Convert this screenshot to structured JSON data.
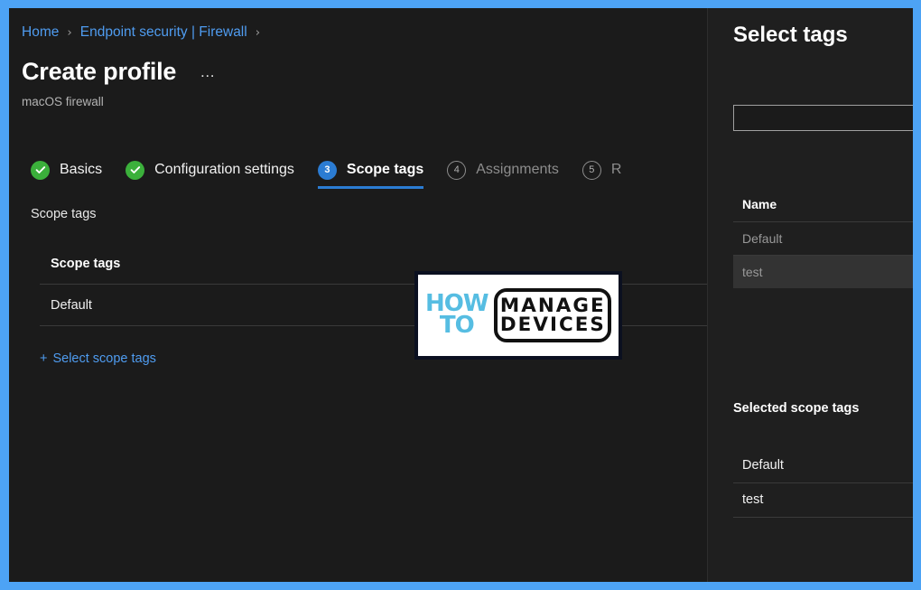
{
  "frame": {
    "border_color": "#4da3f5"
  },
  "breadcrumb": {
    "items": [
      "Home",
      "Endpoint security | Firewall"
    ],
    "separator": "›"
  },
  "header": {
    "title": "Create profile",
    "overflow_menu": "…",
    "subtitle": "macOS firewall"
  },
  "wizard": {
    "steps": [
      {
        "number": "1",
        "label": "Basics",
        "state": "done"
      },
      {
        "number": "2",
        "label": "Configuration settings",
        "state": "done"
      },
      {
        "number": "3",
        "label": "Scope tags",
        "state": "active"
      },
      {
        "number": "4",
        "label": "Assignments",
        "state": "todo"
      },
      {
        "number": "5",
        "label": "R",
        "state": "todo"
      }
    ]
  },
  "main": {
    "section_label": "Scope tags",
    "table": {
      "header": "Scope tags",
      "rows": [
        "Default"
      ]
    },
    "select_link": {
      "plus": "+",
      "label": "Select scope tags"
    }
  },
  "panel": {
    "title": "Select tags",
    "search": {
      "value": "",
      "placeholder": ""
    },
    "list_header": "Name",
    "list_rows": [
      {
        "name": "Default",
        "selected": false
      },
      {
        "name": "test",
        "selected": true
      }
    ],
    "selected_header": "Selected scope tags",
    "selected_rows": [
      "Default",
      "test"
    ]
  },
  "watermark": {
    "how": "HOW",
    "to": "TO",
    "manage": "MANAGE",
    "devices": "DEVICES"
  }
}
